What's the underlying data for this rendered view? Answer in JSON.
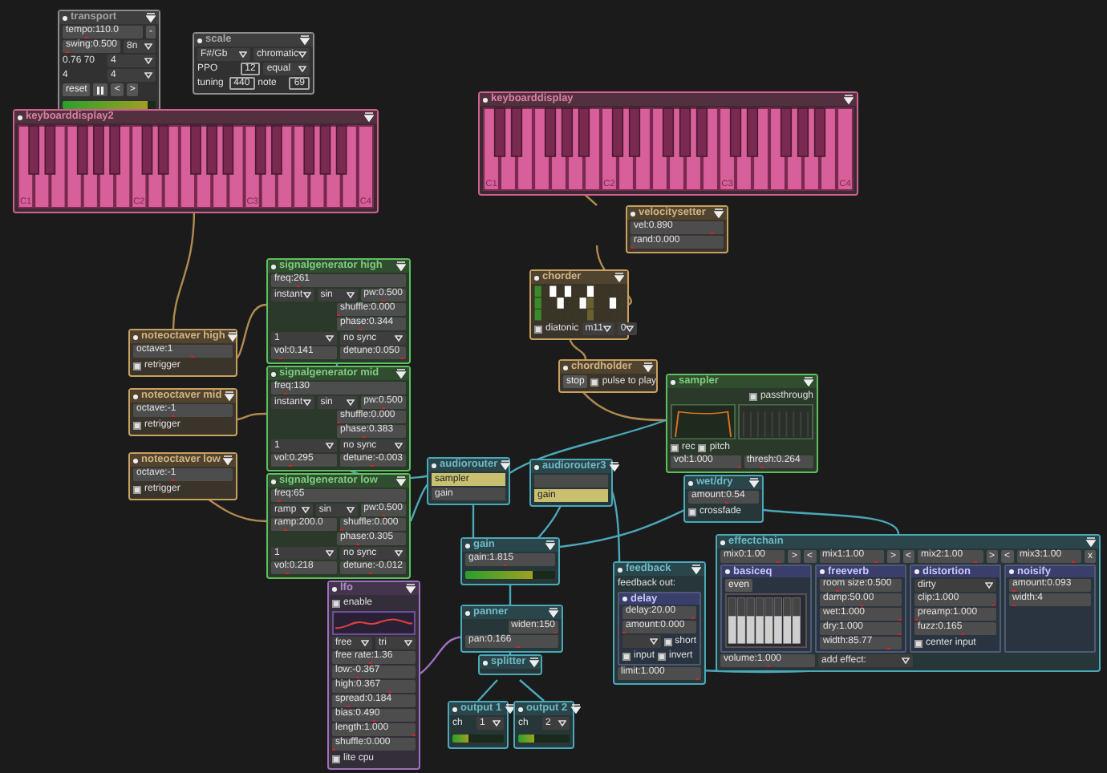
{
  "modules": [
    {
      "title": "transport",
      "kind": "module",
      "color": "#8c8c8c",
      "rows": [
        {
          "controls": [
            {
              "kind": "slider",
              "text": "tempo:110.0",
              "level": 0.3
            },
            {
              "kind": "button",
              "label": "-"
            }
          ]
        },
        {
          "controls": [
            {
              "kind": "slider",
              "text": "swing:0.500",
              "level": 0.05
            },
            {
              "kind": "dropdown",
              "value": "8n"
            }
          ]
        },
        {
          "controls": [
            {
              "kind": "text",
              "text": "0.76 70"
            },
            {
              "kind": "dropdown",
              "value": "4"
            }
          ]
        },
        {
          "controls": [
            {
              "kind": "text",
              "text": "4"
            },
            {
              "kind": "dropdown",
              "value": "4"
            }
          ]
        },
        {
          "controls": [
            {
              "kind": "button",
              "label": "reset"
            },
            {
              "kind": "pause"
            },
            {
              "kind": "button",
              "label": "<"
            },
            {
              "kind": "button",
              "label": ">"
            }
          ]
        },
        {
          "controls": [
            {
              "kind": "meter",
              "level": 0.92
            }
          ]
        }
      ]
    },
    {
      "title": "scale",
      "kind": "module",
      "color": "#8c8c8c",
      "rows": [
        {
          "controls": [
            {
              "kind": "dropdown",
              "value": "F#/Gb"
            },
            {
              "kind": "dropdown",
              "value": "chromatic"
            }
          ]
        },
        {
          "controls": [
            {
              "kind": "text",
              "text": "PPO"
            },
            {
              "kind": "field",
              "value": "12"
            },
            {
              "kind": "dropdown",
              "value": "equal"
            }
          ]
        },
        {
          "controls": [
            {
              "kind": "text",
              "text": "tuning"
            },
            {
              "kind": "field",
              "value": "440"
            },
            {
              "kind": "text",
              "text": "note"
            },
            {
              "kind": "field",
              "value": "69"
            }
          ]
        }
      ]
    },
    {
      "title": "keyboarddisplay2",
      "kind": "keyboard",
      "color": "#d0608f",
      "octave_labels": [
        "C1",
        "C2",
        "C3",
        "C4"
      ]
    },
    {
      "title": "keyboarddisplay",
      "kind": "keyboard",
      "color": "#d0608f",
      "octave_labels": [
        "C1",
        "C2",
        "C3",
        "C4"
      ]
    },
    {
      "title": "velocitysetter",
      "kind": "module",
      "color": "#c8a060",
      "rows": [
        {
          "controls": [
            {
              "kind": "slider",
              "text": "vel:0.890",
              "level": 0.89
            }
          ]
        },
        {
          "controls": [
            {
              "kind": "slider",
              "text": "rand:0.000",
              "level": 0
            }
          ]
        }
      ]
    },
    {
      "title": "chorder",
      "kind": "module",
      "color": "#c8a060",
      "rows": [
        {
          "controls": [
            {
              "kind": "chord_grid"
            }
          ]
        },
        {
          "controls": [
            {
              "kind": "checkbox",
              "label": "diatonic",
              "checked": false
            },
            {
              "kind": "dropdown",
              "value": "m11"
            },
            {
              "kind": "dropdown",
              "value": "0"
            }
          ]
        }
      ]
    },
    {
      "title": "chordholder",
      "kind": "module",
      "color": "#c8a060",
      "rows": [
        {
          "controls": [
            {
              "kind": "button",
              "label": "stop"
            },
            {
              "kind": "checkbox",
              "label": "pulse to play",
              "checked": false
            }
          ]
        }
      ]
    },
    {
      "title": "signalgenerator high",
      "kind": "module",
      "color": "#5fbf5f",
      "rows": [
        {
          "controls": [
            {
              "kind": "slider",
              "text": "freq:261",
              "level": 0.2
            }
          ]
        },
        {
          "controls": [
            {
              "kind": "dropdown",
              "value": "instant"
            },
            {
              "kind": "dropdown",
              "value": "sin"
            },
            {
              "kind": "slider",
              "text": "pw:0.500",
              "level": 0.5
            }
          ]
        },
        {
          "controls": [
            {
              "kind": "gap"
            },
            {
              "kind": "slider",
              "text": "shuffle:0.000",
              "level": 0
            }
          ]
        },
        {
          "controls": [
            {
              "kind": "gap"
            },
            {
              "kind": "slider",
              "text": "phase:0.344",
              "level": 0.34
            }
          ]
        },
        {
          "controls": [
            {
              "kind": "dropdown",
              "value": "1"
            },
            {
              "kind": "dropdown",
              "value": "no sync"
            }
          ]
        },
        {
          "controls": [
            {
              "kind": "slider",
              "text": "vol:0.141",
              "level": 0.14
            },
            {
              "kind": "slider",
              "text": "detune:0.050",
              "level": 0.98
            }
          ]
        }
      ]
    },
    {
      "title": "signalgenerator mid",
      "kind": "module",
      "color": "#5fbf5f",
      "rows": [
        {
          "controls": [
            {
              "kind": "slider",
              "text": "freq:130",
              "level": 0.1
            }
          ]
        },
        {
          "controls": [
            {
              "kind": "dropdown",
              "value": "instant"
            },
            {
              "kind": "dropdown",
              "value": "sin"
            },
            {
              "kind": "slider",
              "text": "pw:0.500",
              "level": 0.5
            }
          ]
        },
        {
          "controls": [
            {
              "kind": "gap"
            },
            {
              "kind": "slider",
              "text": "shuffle:0.000",
              "level": 0
            }
          ]
        },
        {
          "controls": [
            {
              "kind": "gap"
            },
            {
              "kind": "slider",
              "text": "phase:0.383",
              "level": 0.38
            }
          ]
        },
        {
          "controls": [
            {
              "kind": "dropdown",
              "value": "1"
            },
            {
              "kind": "dropdown",
              "value": "no sync"
            }
          ]
        },
        {
          "controls": [
            {
              "kind": "slider",
              "text": "vol:0.295",
              "level": 0.29
            },
            {
              "kind": "slider",
              "text": "detune:-0.003",
              "level": 0.49
            }
          ]
        }
      ]
    },
    {
      "title": "signalgenerator low",
      "kind": "module",
      "color": "#5fbf5f",
      "rows": [
        {
          "controls": [
            {
              "kind": "slider",
              "text": "freq:65",
              "level": 0.05
            }
          ]
        },
        {
          "controls": [
            {
              "kind": "dropdown",
              "value": "ramp"
            },
            {
              "kind": "dropdown",
              "value": "sin"
            },
            {
              "kind": "slider",
              "text": "pw:0.500",
              "level": 0.5
            }
          ]
        },
        {
          "controls": [
            {
              "kind": "slider",
              "text": "ramp:200.0",
              "level": 0.2
            },
            {
              "kind": "slider",
              "text": "shuffle:0.000",
              "level": 0
            }
          ]
        },
        {
          "controls": [
            {
              "kind": "gap"
            },
            {
              "kind": "slider",
              "text": "phase:0.305",
              "level": 0.3
            }
          ]
        },
        {
          "controls": [
            {
              "kind": "dropdown",
              "value": "1"
            },
            {
              "kind": "dropdown",
              "value": "no sync"
            }
          ]
        },
        {
          "controls": [
            {
              "kind": "slider",
              "text": "vol:0.218",
              "level": 0.22
            },
            {
              "kind": "slider",
              "text": "detune:-0.012",
              "level": 0.47
            }
          ]
        }
      ]
    },
    {
      "title": "noteoctaver high",
      "kind": "module",
      "color": "#c8a060",
      "rows": [
        {
          "controls": [
            {
              "kind": "slider",
              "text": "octave:1",
              "level": 0.6
            }
          ]
        },
        {
          "controls": [
            {
              "kind": "checkbox",
              "label": "retrigger",
              "checked": false
            }
          ]
        }
      ]
    },
    {
      "title": "noteoctaver mid",
      "kind": "module",
      "color": "#c8a060",
      "rows": [
        {
          "controls": [
            {
              "kind": "slider",
              "text": "octave:-1",
              "level": 0.4
            }
          ]
        },
        {
          "controls": [
            {
              "kind": "checkbox",
              "label": "retrigger",
              "checked": false
            }
          ]
        }
      ]
    },
    {
      "title": "noteoctaver low",
      "kind": "module",
      "color": "#c8a060",
      "rows": [
        {
          "controls": [
            {
              "kind": "slider",
              "text": "octave:-1",
              "level": 0.4
            }
          ]
        },
        {
          "controls": [
            {
              "kind": "checkbox",
              "label": "retrigger",
              "checked": false
            }
          ]
        }
      ]
    },
    {
      "title": "audiorouter",
      "kind": "module",
      "color": "#4aa8b8",
      "rows": [
        {
          "controls": [
            {
              "kind": "option",
              "text": "sampler",
              "selected": true
            }
          ]
        },
        {
          "controls": [
            {
              "kind": "option",
              "text": "gain",
              "selected": false
            }
          ]
        }
      ]
    },
    {
      "title": "audiorouter3",
      "kind": "module",
      "color": "#4aa8b8",
      "rows": [
        {
          "controls": [
            {
              "kind": "option",
              "selected": false
            }
          ]
        },
        {
          "controls": [
            {
              "kind": "option",
              "text": "gain",
              "selected": true
            }
          ]
        }
      ]
    },
    {
      "title": "sampler",
      "kind": "module",
      "color": "#5fbf5f",
      "rows": [
        {
          "controls": [
            {
              "kind": "gap"
            },
            {
              "kind": "checkbox",
              "label": "passthrough",
              "checked": false
            }
          ]
        },
        {
          "controls": [
            {
              "kind": "sample_display"
            }
          ]
        },
        {
          "controls": [
            {
              "kind": "checkbox",
              "label": "rec",
              "checked": false
            },
            {
              "kind": "checkbox",
              "label": "pitch",
              "checked": false
            }
          ]
        },
        {
          "controls": [
            {
              "kind": "slider",
              "text": "vol:1.000",
              "level": 1
            },
            {
              "kind": "slider",
              "text": "thresh:0.264",
              "level": 0.26
            }
          ]
        }
      ]
    },
    {
      "title": "wet/dry",
      "kind": "module",
      "color": "#4aa8b8",
      "rows": [
        {
          "controls": [
            {
              "kind": "slider",
              "text": "amount:0.54",
              "level": 0.54
            }
          ]
        },
        {
          "controls": [
            {
              "kind": "checkbox",
              "label": "crossfade",
              "checked": false
            }
          ]
        }
      ]
    },
    {
      "title": "gain",
      "kind": "module",
      "color": "#4aa8b8",
      "rows": [
        {
          "controls": [
            {
              "kind": "slider",
              "text": "gain:1.815",
              "level": 0.45
            }
          ]
        },
        {
          "controls": [
            {
              "kind": "meter",
              "level": 0.75
            }
          ]
        }
      ]
    },
    {
      "title": "panner",
      "kind": "module",
      "color": "#4aa8b8",
      "rows": [
        {
          "controls": [
            {
              "kind": "gap"
            },
            {
              "kind": "slider",
              "text": "widen:150",
              "level": 0.98
            }
          ]
        },
        {
          "controls": [
            {
              "kind": "slider",
              "text": "pan:0.166",
              "level": 0.58
            }
          ]
        }
      ]
    },
    {
      "title": "splitter",
      "kind": "module",
      "color": "#4aa8b8"
    },
    {
      "title": "output 1",
      "kind": "module",
      "color": "#4aa8b8",
      "rows": [
        {
          "controls": [
            {
              "kind": "text",
              "text": "ch"
            },
            {
              "kind": "dropdown",
              "value": "1"
            }
          ]
        },
        {
          "controls": [
            {
              "kind": "meter",
              "level": 0.3
            }
          ]
        }
      ]
    },
    {
      "title": "output 2",
      "kind": "module",
      "color": "#4aa8b8",
      "rows": [
        {
          "controls": [
            {
              "kind": "text",
              "text": "ch"
            },
            {
              "kind": "dropdown",
              "value": "2"
            }
          ]
        },
        {
          "controls": [
            {
              "kind": "meter",
              "level": 0.3
            }
          ]
        }
      ]
    },
    {
      "title": "lfo",
      "kind": "module",
      "color": "#a070c0",
      "rows": [
        {
          "controls": [
            {
              "kind": "checkbox",
              "label": "enable",
              "checked": false
            }
          ]
        },
        {
          "controls": [
            {
              "kind": "lfo_wave"
            }
          ]
        },
        {
          "controls": [
            {
              "kind": "dropdown",
              "value": "free"
            },
            {
              "kind": "dropdown",
              "value": "tri"
            }
          ]
        },
        {
          "controls": [
            {
              "kind": "slider",
              "text": "free rate:1.36",
              "level": 0.45
            }
          ]
        },
        {
          "controls": [
            {
              "kind": "slider",
              "text": "low:-0.367",
              "level": 0.3
            }
          ]
        },
        {
          "controls": [
            {
              "kind": "slider",
              "text": "high:0.367",
              "level": 0.7
            }
          ]
        },
        {
          "controls": [
            {
              "kind": "slider",
              "text": "spread:0.184",
              "level": 0.18
            }
          ]
        },
        {
          "controls": [
            {
              "kind": "slider",
              "text": "bias:0.490",
              "level": 0.49
            }
          ]
        },
        {
          "controls": [
            {
              "kind": "slider",
              "text": "length:1.000",
              "level": 1
            }
          ]
        },
        {
          "controls": [
            {
              "kind": "slider",
              "text": "shuffle:0.000",
              "level": 0
            }
          ]
        },
        {
          "controls": [
            {
              "kind": "checkbox",
              "label": "lite cpu",
              "checked": false
            }
          ]
        }
      ]
    },
    {
      "title": "feedback",
      "kind": "module",
      "color": "#4aa8b8",
      "rows": [
        {
          "controls": [
            {
              "kind": "text",
              "text": "feedback out:"
            }
          ]
        },
        {
          "controls": [
            {
              "kind": "sub",
              "title": "delay",
              "rows": [
                {
                  "controls": [
                    {
                      "kind": "slider",
                      "text": "delay:20.00",
                      "level": 0.98
                    }
                  ]
                },
                {
                  "controls": [
                    {
                      "kind": "slider",
                      "text": "amount:0.000",
                      "level": 0
                    }
                  ]
                },
                {
                  "controls": [
                    {
                      "kind": "dropdown"
                    },
                    {
                      "kind": "checkbox",
                      "label": "short",
                      "checked": false
                    }
                  ]
                },
                {
                  "controls": [
                    {
                      "kind": "checkbox",
                      "label": "input",
                      "checked": false
                    },
                    {
                      "kind": "checkbox",
                      "label": "invert",
                      "checked": false
                    }
                  ]
                }
              ]
            }
          ]
        },
        {
          "controls": [
            {
              "kind": "slider",
              "text": "limit:1.000",
              "level": 0.98
            }
          ]
        }
      ]
    },
    {
      "title": "effectchain",
      "kind": "module",
      "color": "#4aa8b8",
      "rows": [
        {
          "controls": [
            {
              "kind": "slider",
              "text": "mix0:1.00",
              "level": 0.9
            },
            {
              "kind": "button",
              "label": ">"
            },
            {
              "kind": "button",
              "label": "<"
            },
            {
              "kind": "slider",
              "text": "mix1:1.00",
              "level": 0.9
            },
            {
              "kind": "button",
              "label": ">"
            },
            {
              "kind": "button",
              "label": "<"
            },
            {
              "kind": "slider",
              "text": "mix2:1.00",
              "level": 0.9
            },
            {
              "kind": "button",
              "label": ">"
            },
            {
              "kind": "button",
              "label": "<"
            },
            {
              "kind": "slider",
              "text": "mix3:1.00",
              "level": 0.9
            },
            {
              "kind": "button",
              "label": "x"
            }
          ]
        },
        {
          "controls": [
            {
              "kind": "sub",
              "title": "basiceq",
              "rows": [
                {
                  "controls": [
                    {
                      "kind": "button",
                      "label": "even"
                    }
                  ]
                },
                {
                  "controls": [
                    {
                      "kind": "eq_graph"
                    }
                  ]
                }
              ]
            },
            {
              "kind": "sub",
              "title": "freeverb",
              "rows": [
                {
                  "controls": [
                    {
                      "kind": "slider",
                      "text": "room size:0.500",
                      "level": 0.2
                    }
                  ]
                },
                {
                  "controls": [
                    {
                      "kind": "slider",
                      "text": "damp:50.00",
                      "level": 0.5
                    }
                  ]
                },
                {
                  "controls": [
                    {
                      "kind": "slider",
                      "text": "wet:1.000",
                      "level": 1
                    }
                  ]
                },
                {
                  "controls": [
                    {
                      "kind": "slider",
                      "text": "dry:1.000",
                      "level": 1
                    }
                  ]
                },
                {
                  "controls": [
                    {
                      "kind": "slider",
                      "text": "width:85.77",
                      "level": 0.86
                    }
                  ]
                }
              ]
            },
            {
              "kind": "sub",
              "title": "distortion",
              "rows": [
                {
                  "controls": [
                    {
                      "kind": "dropdown",
                      "value": "dirty"
                    }
                  ]
                },
                {
                  "controls": [
                    {
                      "kind": "slider",
                      "text": "clip:1.000",
                      "level": 0.98
                    }
                  ]
                },
                {
                  "controls": [
                    {
                      "kind": "slider",
                      "text": "preamp:1.000",
                      "level": 0
                    }
                  ]
                },
                {
                  "controls": [
                    {
                      "kind": "slider",
                      "text": "fuzz:0.165",
                      "level": 0.6
                    }
                  ]
                },
                {
                  "controls": [
                    {
                      "kind": "checkbox",
                      "label": "center input",
                      "checked": false
                    }
                  ]
                }
              ]
            },
            {
              "kind": "sub",
              "title": "noisify",
              "rows": [
                {
                  "controls": [
                    {
                      "kind": "slider",
                      "text": "amount:0.093",
                      "level": 0.05
                    }
                  ]
                },
                {
                  "controls": [
                    {
                      "kind": "slider",
                      "text": "width:4",
                      "level": 0.05
                    }
                  ]
                }
              ]
            }
          ]
        },
        {
          "controls": [
            {
              "kind": "slider",
              "text": "volume:1.000",
              "level": 0.5
            },
            {
              "kind": "dropdown",
              "value": "add effect:"
            },
            {
              "kind": "gap"
            },
            {
              "kind": "gap"
            }
          ]
        }
      ]
    }
  ]
}
